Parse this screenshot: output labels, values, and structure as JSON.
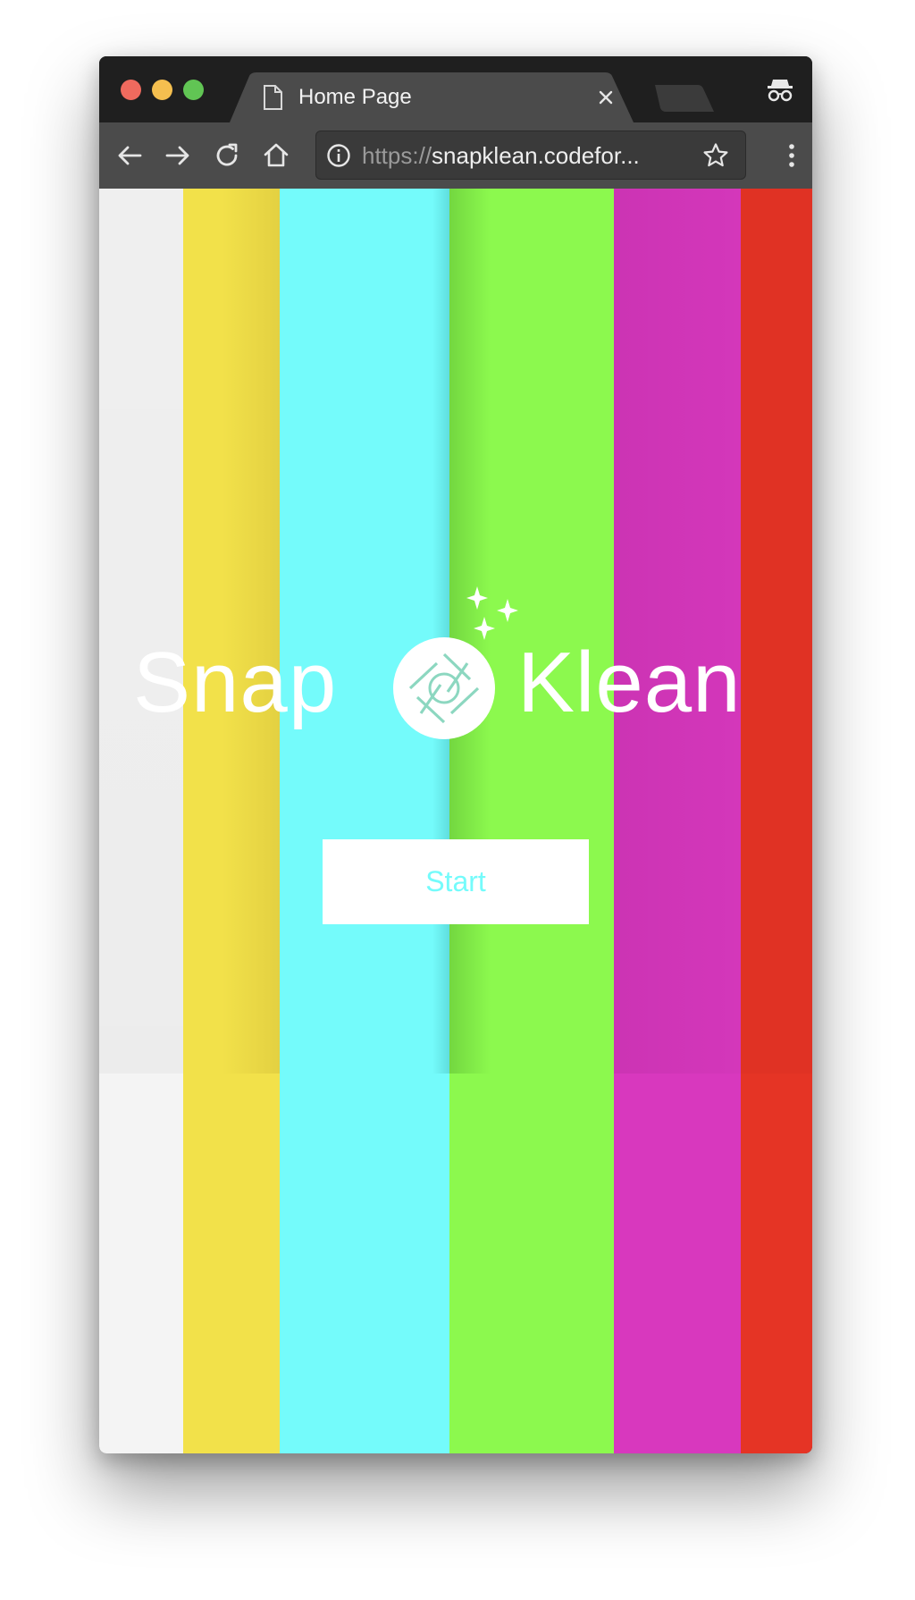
{
  "browser": {
    "tab": {
      "title": "Home Page"
    },
    "address_bar": {
      "scheme": "https://",
      "host": "snapklean.codefor..."
    },
    "icons": {
      "tab_icon": "document-icon",
      "tab_close": "close-icon",
      "new_tab": "new-tab-icon",
      "incognito": "incognito-icon",
      "back": "back-arrow-icon",
      "forward": "forward-arrow-icon",
      "reload": "reload-icon",
      "home": "home-icon",
      "site_info": "info-icon",
      "bookmark": "star-icon",
      "menu": "kebab-menu-icon"
    }
  },
  "page": {
    "logo": {
      "word_left": "Snap",
      "word_right": "Klean",
      "mark_icon": "camera-aperture-icon",
      "sparkle_icon": "sparkles-icon"
    },
    "start_button": {
      "label": "Start"
    },
    "background_bars": [
      {
        "name": "white",
        "color": "#f4f4f4"
      },
      {
        "name": "yellow",
        "color": "#f2e14a"
      },
      {
        "name": "cyan",
        "color": "#74fbfb"
      },
      {
        "name": "green",
        "color": "#8cf94e"
      },
      {
        "name": "magenta",
        "color": "#d838be"
      },
      {
        "name": "red",
        "color": "#e53425"
      }
    ]
  },
  "colors": {
    "accent_text": "#74fbfb",
    "chrome_dark": "#1f1f1f",
    "chrome_toolbar": "#4b4b4b",
    "chrome_tab": "#4b4b4b"
  }
}
